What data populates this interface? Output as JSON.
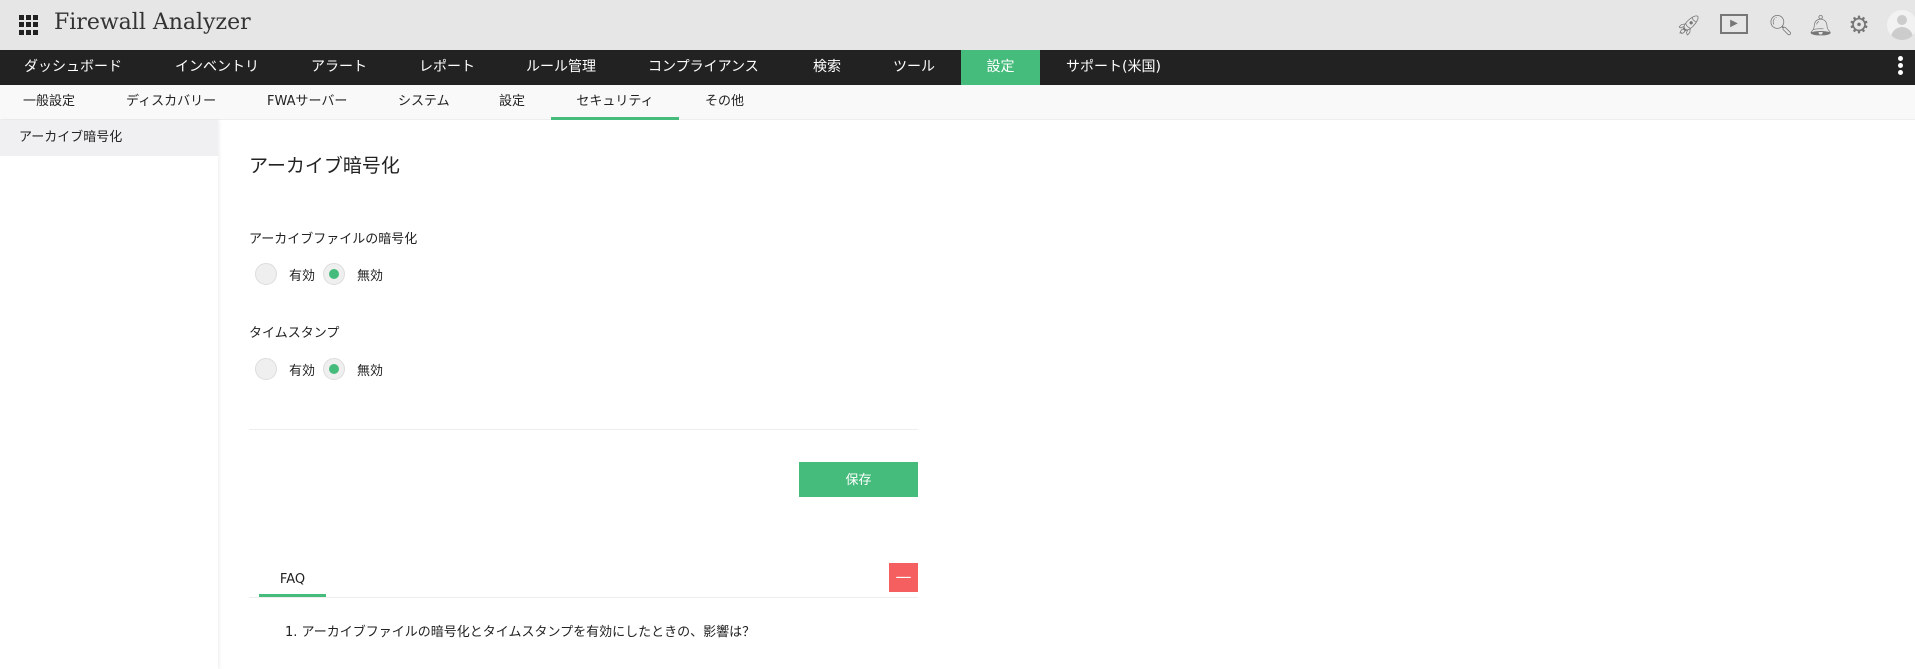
{
  "header": {
    "app_title": "Firewall Analyzer",
    "icons": [
      "rocket-icon",
      "presentation-icon",
      "search-icon",
      "bell-icon",
      "gear-icon",
      "avatar-icon"
    ]
  },
  "nav": {
    "items": [
      "ダッシュボード",
      "インベントリ",
      "アラート",
      "レポート",
      "ルール管理",
      "コンプライアンス",
      "検索",
      "ツール",
      "設定",
      "サポート(米国)"
    ],
    "active": "設定"
  },
  "subnav": {
    "items": [
      "一般設定",
      "ディスカバリー",
      "FWAサーバー",
      "システム",
      "設定",
      "セキュリティ",
      "その他"
    ],
    "active": "セキュリティ"
  },
  "sidebar": {
    "items": [
      "アーカイブ暗号化"
    ]
  },
  "main": {
    "title": "アーカイブ暗号化",
    "archive_encryption": {
      "label": "アーカイブファイルの暗号化",
      "options": [
        "有効",
        "無効"
      ],
      "selected": "無効"
    },
    "timestamp": {
      "label": "タイムスタンプ",
      "options": [
        "有効",
        "無効"
      ],
      "selected": "無効"
    },
    "save_label": "保存",
    "faq": {
      "tab": "FAQ",
      "collapse_label": "—",
      "questions": [
        "1. アーカイブファイルの暗号化とタイムスタンプを有効にしたときの、影響は？"
      ]
    }
  },
  "colors": {
    "accent": "#45bc7b",
    "nav_bg": "#222222",
    "collapse": "#f55f5f"
  }
}
